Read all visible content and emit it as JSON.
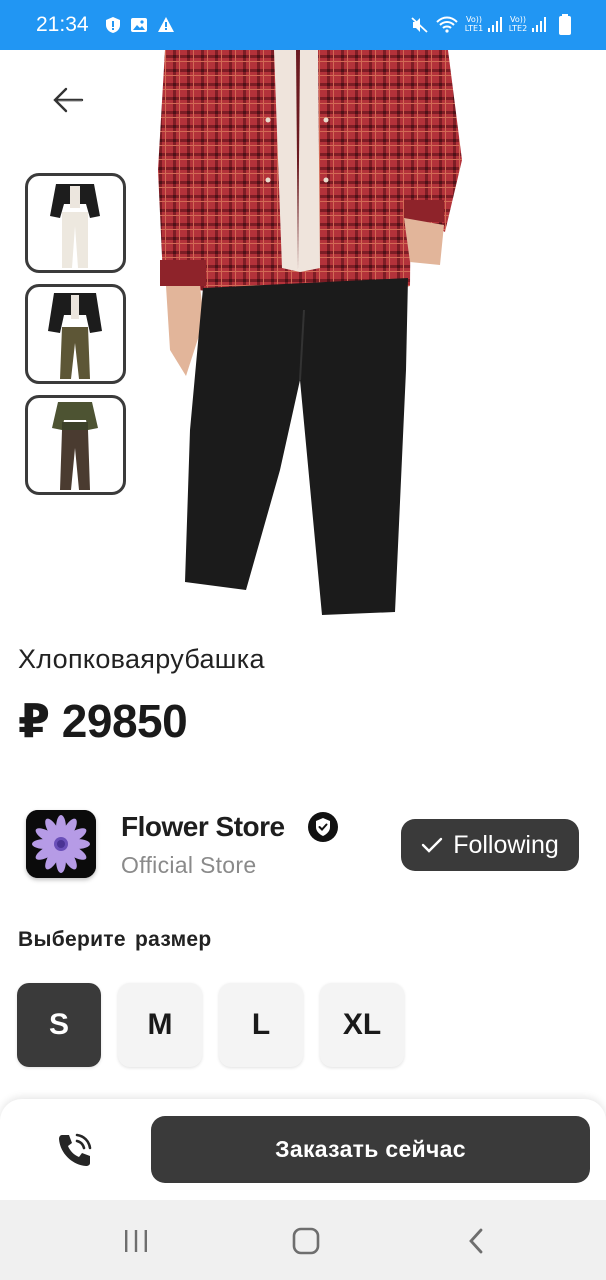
{
  "status_bar": {
    "time": "21:34",
    "icons": [
      "shield-icon",
      "image-icon",
      "warning-icon",
      "mute-icon",
      "wifi-icon",
      "signal-lte1-icon",
      "signal-lte2-icon",
      "battery-icon"
    ],
    "sim1_top": "Vo))",
    "sim1_bottom": "LTE1",
    "sim2_top": "Vo))",
    "sim2_bottom": "LTE2"
  },
  "product": {
    "name": "Хлопковаярубашка",
    "price": "₽ 29850",
    "thumbnails": [
      "thumbnail-1",
      "thumbnail-2",
      "thumbnail-3"
    ]
  },
  "store": {
    "name": "Flower Store",
    "subtitle": "Official Store",
    "follow_label": "Following"
  },
  "sizes": {
    "title": "Выберите размер",
    "options": [
      "S",
      "M",
      "L",
      "XL"
    ],
    "selected": "S"
  },
  "actions": {
    "order_label": "Заказать сейчас"
  },
  "colors": {
    "status_bar": "#2196f3",
    "dark_button": "#3a3a3a",
    "size_bg": "#f4f4f4",
    "nav_bar": "#f0f0f0",
    "shirt_red": "#b3323a",
    "pants": "#1b1b1b"
  }
}
